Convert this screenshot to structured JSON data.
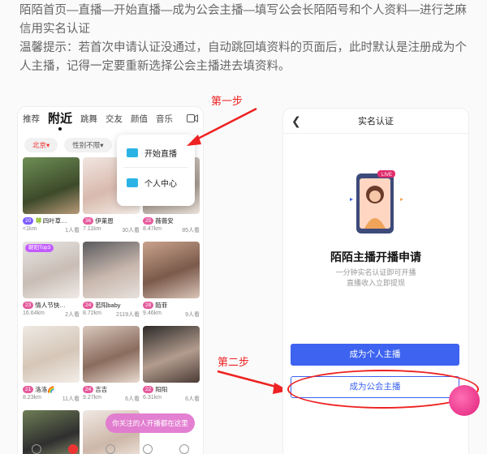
{
  "intro": {
    "line1": "陌陌首页—直播—开始直播—成为公会主播—填写公会长陌陌号和个人资料—进行芝麻信用实名认证",
    "line2": "温馨提示：若首次申请认证没通过，自动跳回填资料的页面后，此时默认是注册成为个人主播，记得一定要重新选择公会主播进去填资料。"
  },
  "steps": {
    "step1": "第一步",
    "step2": "第二步"
  },
  "left_phone": {
    "tabs": [
      "推荐",
      "附近",
      "跳舞",
      "交友",
      "颜值",
      "音乐"
    ],
    "active_tab": "附近",
    "filters": [
      "北京▾",
      "性别不限▾"
    ],
    "popup": {
      "start_live": "开始直播",
      "personal_center": "个人中心"
    },
    "cards": [
      {
        "badge": "20",
        "name": "🍀四叶草…",
        "dist": "<1km",
        "views": "1人看"
      },
      {
        "badge": "36",
        "name": "伊莱恩",
        "dist": "7.11km",
        "views": "30人看"
      },
      {
        "badge": "25",
        "name": "薇薇安",
        "dist": "8.47km",
        "views": "85人看"
      },
      {
        "badge": "23",
        "name": "情人节快…",
        "dist": "16.64km",
        "views": "2人看",
        "top": "朝阳Top3"
      },
      {
        "badge": "24",
        "name": "若阳baby",
        "dist": "8.72km",
        "views": "2119人看"
      },
      {
        "badge": "28",
        "name": "陌菲",
        "dist": "9.46km",
        "views": "9人看"
      },
      {
        "badge": "21",
        "name": "洛洛🌈",
        "dist": "8.23km",
        "views": "11人看"
      },
      {
        "badge": "24",
        "name": "吉吉",
        "dist": "9.27km",
        "views": "6人看"
      },
      {
        "badge": "22",
        "name": "阳阳",
        "dist": "6.31km",
        "views": "6人看"
      }
    ],
    "float_pill": "你关注的人开播都在这里"
  },
  "right_phone": {
    "header": "实名认证",
    "live_badge": "LIVE",
    "title": "陌陌主播开播申请",
    "sub1": "一分钟实名认证即可开播",
    "sub2": "直播收入立即提现",
    "btn_personal": "成为个人主播",
    "btn_guild": "成为公会主播"
  },
  "colors": {
    "accent_blue": "#3d63f0",
    "annotation_red": "#e22222"
  }
}
